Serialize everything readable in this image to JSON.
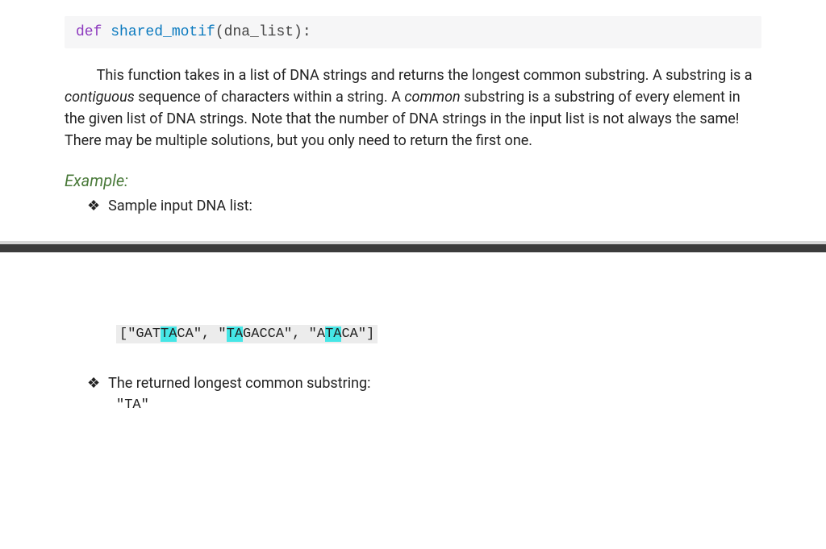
{
  "signature": {
    "def_kw": "def ",
    "fn_name": "shared_motif",
    "args": "(dna_list):"
  },
  "description": {
    "t1": "This function takes in a list of DNA strings and returns the longest common substring. A substring is a ",
    "em1": "contiguous",
    "t2": " sequence of characters within a string. A ",
    "em2": "common",
    "t3": " substring is a substring of every element in the given list of DNA strings. Note that the number of DNA strings in the input list is not always the same! There may be multiple solutions, but you only need to return the first one."
  },
  "example_heading": "Example:",
  "bullet_glyph": "❖",
  "bullet_input_label": "Sample input DNA list:",
  "sample_code": {
    "open": "[\"GAT",
    "h1": "TA",
    "s1": "CA\", \"",
    "h2": "TA",
    "s2": "GACCA\", \"A",
    "h3": "TA",
    "close": "CA\"]"
  },
  "bullet_output_label": "The returned longest common substring:",
  "returned_value": "\"TA\""
}
